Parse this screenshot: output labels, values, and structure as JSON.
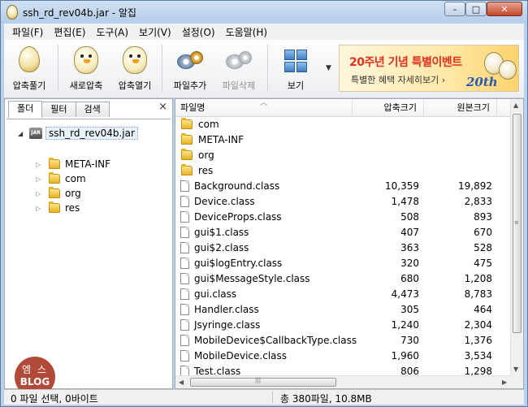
{
  "window": {
    "title": "ssh_rd_rev04b.jar - 알집",
    "minimize": "–",
    "maximize": "□",
    "close": "✕"
  },
  "menu": [
    "파일(F)",
    "편집(E)",
    "도구(A)",
    "보기(V)",
    "설정(O)",
    "도움말(H)"
  ],
  "toolbar": {
    "extract": "압축풀기",
    "new_archive": "새로압축",
    "open_archive": "압축열기",
    "add_file": "파일추가",
    "delete_file": "파일삭제",
    "view": "보기",
    "view_dropdown": "▼"
  },
  "banner": {
    "headline": "20주년 기념 특별이벤트",
    "subline": "특별한 혜택 자세히보기 ›",
    "badge": "20th"
  },
  "left_panel": {
    "tabs": [
      "폴더",
      "필터",
      "검색"
    ],
    "close": "×",
    "root": "ssh_rd_rev04b.jar",
    "root_icon": "JAR",
    "nodes": [
      "META-INF",
      "com",
      "org",
      "res"
    ],
    "watermark": {
      "line1": "엠 스",
      "line2": "BLOG"
    }
  },
  "list": {
    "columns": [
      "파일명",
      "압축크기",
      "원본크기"
    ],
    "rows": [
      {
        "name": "com",
        "type": "folder",
        "packed": "",
        "size": ""
      },
      {
        "name": "META-INF",
        "type": "folder",
        "packed": "",
        "size": ""
      },
      {
        "name": "org",
        "type": "folder",
        "packed": "",
        "size": ""
      },
      {
        "name": "res",
        "type": "folder",
        "packed": "",
        "size": ""
      },
      {
        "name": "Background.class",
        "type": "file",
        "packed": "10,359",
        "size": "19,892"
      },
      {
        "name": "Device.class",
        "type": "file",
        "packed": "1,478",
        "size": "2,833"
      },
      {
        "name": "DeviceProps.class",
        "type": "file",
        "packed": "508",
        "size": "893"
      },
      {
        "name": "gui$1.class",
        "type": "file",
        "packed": "407",
        "size": "670"
      },
      {
        "name": "gui$2.class",
        "type": "file",
        "packed": "363",
        "size": "528"
      },
      {
        "name": "gui$logEntry.class",
        "type": "file",
        "packed": "320",
        "size": "475"
      },
      {
        "name": "gui$MessageStyle.class",
        "type": "file",
        "packed": "680",
        "size": "1,208"
      },
      {
        "name": "gui.class",
        "type": "file",
        "packed": "4,473",
        "size": "8,783"
      },
      {
        "name": "Handler.class",
        "type": "file",
        "packed": "305",
        "size": "464"
      },
      {
        "name": "Jsyringe.class",
        "type": "file",
        "packed": "1,240",
        "size": "2,304"
      },
      {
        "name": "MobileDevice$CallbackType.class",
        "type": "file",
        "packed": "730",
        "size": "1,376"
      },
      {
        "name": "MobileDevice.class",
        "type": "file",
        "packed": "1,960",
        "size": "3,534"
      },
      {
        "name": "Test.class",
        "type": "file",
        "packed": "806",
        "size": "1,298"
      }
    ]
  },
  "status": {
    "left": "0 파일 선택, 0바이트",
    "right": "총 380파일, 10.8MB"
  }
}
